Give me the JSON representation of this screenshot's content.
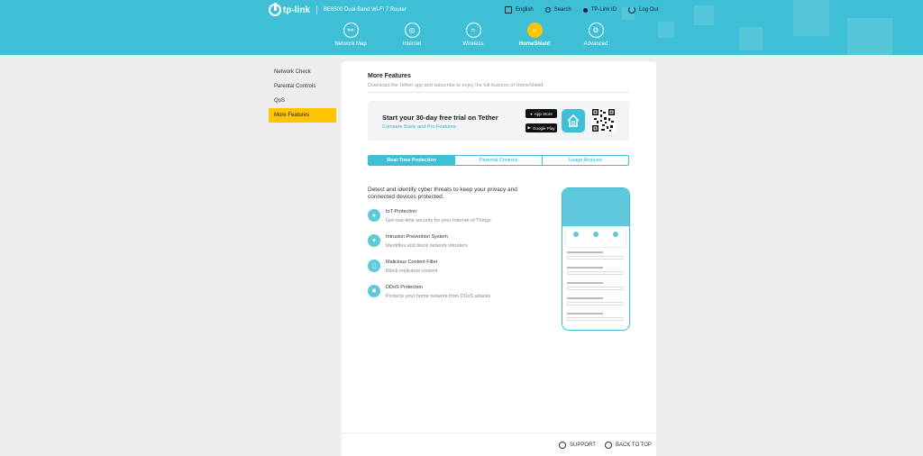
{
  "brand": {
    "logo": "tp-link",
    "model": "BE6500 Dual-Band Wi-Fi 7 Router"
  },
  "toplinks": [
    {
      "label": "English",
      "icon": "language-icon"
    },
    {
      "label": "Search",
      "icon": "search-icon"
    },
    {
      "label": "TP-Link ID",
      "icon": "user-icon"
    },
    {
      "label": "Log Out",
      "icon": "logout-icon"
    }
  ],
  "nav": [
    {
      "label": "Network Map",
      "icon": "network-map-icon"
    },
    {
      "label": "Internet",
      "icon": "globe-icon"
    },
    {
      "label": "Wireless",
      "icon": "wifi-icon"
    },
    {
      "label": "HomeShield",
      "icon": "homeshield-icon",
      "active": true
    },
    {
      "label": "Advanced",
      "icon": "gear-icon"
    }
  ],
  "sidebar": {
    "items": [
      {
        "label": "Network Check"
      },
      {
        "label": "Parental Controls"
      },
      {
        "label": "QoS"
      },
      {
        "label": "More Features",
        "active": true
      }
    ]
  },
  "main": {
    "title": "More Features",
    "subtitle": "Download the Tether app and subscribe to enjoy the full features of HomeShield.",
    "trial": {
      "heading": "Start your 30-day free trial on Tether",
      "link": "Compare Basic and Pro Features",
      "app_store": "App Store",
      "google_play": "Google Play"
    },
    "tabs": [
      {
        "label": "Real-Time Protection",
        "active": true
      },
      {
        "label": "Parental Controls"
      },
      {
        "label": "Usage Analysis"
      }
    ],
    "intro": "Detect and identify cyber threats to keep your privacy and connected devices protected.",
    "features": [
      {
        "name": "IoT Protection",
        "desc": "Get real-time security for your Internet of Things",
        "icon": "iot-icon"
      },
      {
        "name": "Intrusion Prevention System",
        "desc": "Identifies and block network intruders",
        "icon": "intrusion-icon"
      },
      {
        "name": "Malicious Content Filter",
        "desc": "Block malicious content",
        "icon": "filter-icon"
      },
      {
        "name": "DDoS Protection",
        "desc": "Protects your home network from DDoS attacks",
        "icon": "ddos-icon"
      }
    ]
  },
  "footer": {
    "support": "SUPPORT",
    "back_to_top": "BACK TO TOP"
  },
  "colors": {
    "accent": "#3fbfd6",
    "highlight": "#ffc400"
  }
}
